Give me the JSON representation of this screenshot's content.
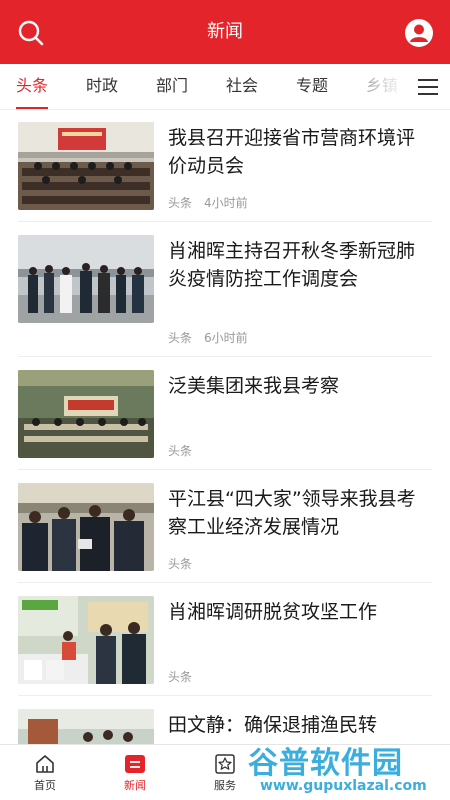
{
  "header": {
    "title": "新闻"
  },
  "tabs": [
    {
      "label": "头条"
    },
    {
      "label": "时政"
    },
    {
      "label": "部门"
    },
    {
      "label": "社会"
    },
    {
      "label": "专题"
    },
    {
      "label": "乡镇"
    }
  ],
  "articles": [
    {
      "title": "我县召开迎接省市营商环境评价动员会",
      "category": "头条",
      "time": "4小时前"
    },
    {
      "title": "肖湘晖主持召开秋冬季新冠肺炎疫情防控工作调度会",
      "category": "头条",
      "time": "6小时前"
    },
    {
      "title": "泛美集团来我县考察",
      "category": "头条",
      "time": ""
    },
    {
      "title": "平江县“四大家”领导来我县考察工业经济发展情况",
      "category": "头条",
      "time": ""
    },
    {
      "title": "肖湘晖调研脱贫攻坚工作",
      "category": "头条",
      "time": ""
    },
    {
      "title": "田文静：确保退捕渔民转",
      "category": "",
      "time": ""
    }
  ],
  "bottom_nav": [
    {
      "label": "首页"
    },
    {
      "label": "新闻"
    },
    {
      "label": "服务"
    }
  ],
  "watermark": {
    "main": "谷普软件园",
    "url": "www.gupuxlazal.com"
  },
  "colors": {
    "brand_red": "#e3252b",
    "meta_gray": "#999999",
    "watermark_blue": "#1aa0d8"
  }
}
